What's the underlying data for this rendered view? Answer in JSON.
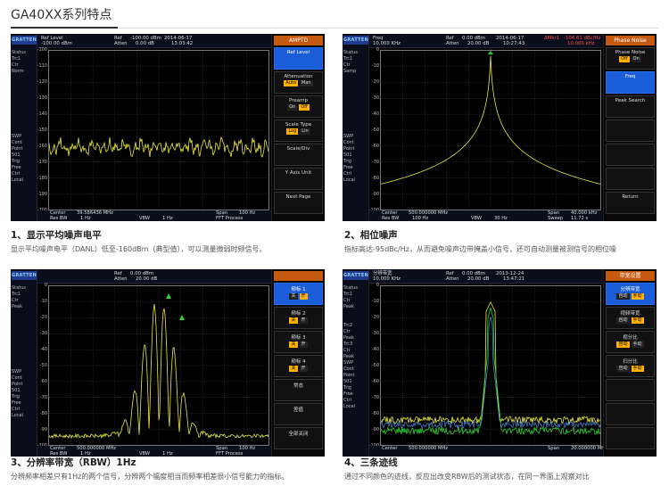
{
  "header": {
    "title": "GA40XX系列特点"
  },
  "brand": "GRATTEN",
  "panels": [
    {
      "top": {
        "ref_label": "Ref Level",
        "ref_val": "-100.00 dBm",
        "ref": "Ref",
        "ref_db": "-100.00 dBm",
        "atten": "Atten",
        "atten_db": "0.00 dB",
        "date": "2014-06-17",
        "time": "13:03:42"
      },
      "status": [
        "Status",
        "Trc1",
        "Ctr",
        "Norm"
      ],
      "side": [
        "SWP",
        "Cont",
        "Point",
        "501",
        "Trig",
        "Free",
        "Ctrl",
        "Local"
      ],
      "yaxis": [
        "-100",
        "-110",
        "-120",
        "-130",
        "-140",
        "-150",
        "-160",
        "-170",
        "-180",
        "-190",
        "-200"
      ],
      "bottom": {
        "center": "Center",
        "center_v": "39.586436 MHz",
        "rbw": "Res BW",
        "rbw_v": "1 Hz",
        "vbw": "VBW",
        "vbw_v": "1 Hz",
        "span": "Span",
        "span_v": "100 Hz",
        "fft": "FFT Process"
      },
      "menu_title": "AMPTD",
      "softkeys": [
        {
          "label": "Ref Level",
          "active": true
        },
        {
          "label": "Attenuation",
          "opts": [
            "Auto",
            "Man"
          ],
          "on": 0
        },
        {
          "label": "Preamp",
          "opts": [
            "On",
            "Off"
          ],
          "on": 1
        },
        {
          "label": "Scale Type",
          "opts": [
            "Log",
            "Lin"
          ],
          "on": 0
        },
        {
          "label": "Scale/Div"
        },
        {
          "label": "Y Axis Unit"
        },
        {
          "label": "Next Page"
        }
      ]
    },
    {
      "top": {
        "ref_label": "Freq",
        "ref_val": "10.000 KHz",
        "ref": "Ref",
        "ref_db": "0.00 dBm",
        "atten": "Atten",
        "atten_db": "20.00 dB",
        "date": "2014-06-17",
        "time": "10:27:43",
        "mk_label": "ΔMkr1",
        "mk_val": "-104.61 dBc/Hz",
        "mk_f": "10.000 kHz"
      },
      "status": [
        "Status",
        "Trc1",
        "Ctr",
        "Samp"
      ],
      "side": [
        "SWP",
        "Cont",
        "Point",
        "501",
        "Trig",
        "Free",
        "Ctrl",
        "Local"
      ],
      "yaxis": [
        "0",
        "-10",
        "-20",
        "-30",
        "-40",
        "-50",
        "-60",
        "-70",
        "-80",
        "-90",
        "-100"
      ],
      "bottom": {
        "center": "Center",
        "center_v": "500.000000 MHz",
        "rbw": "Res BW",
        "rbw_v": "100 Hz",
        "vbw": "VBW",
        "vbw_v": "30 Hz",
        "span": "Span",
        "span_v": "40.000 kHz",
        "fft": "Sweep",
        "sweep_v": "11.72 s"
      },
      "menu_title": "Phase Noise",
      "softkeys": [
        {
          "label": "Phase Noise",
          "opts": [
            "Off",
            "On"
          ],
          "on": 0
        },
        {
          "label": "Freq",
          "active": true
        },
        {
          "label": "Peak Search"
        },
        {
          "label": ""
        },
        {
          "label": ""
        },
        {
          "label": ""
        },
        {
          "label": "Return"
        }
      ]
    },
    {
      "top": {
        "ref_label": "",
        "ref_val": "",
        "ref": "Ref",
        "ref_db": "0.00 dBm",
        "atten": "Atten",
        "atten_db": "20.00 dB",
        "date": "",
        "time": ""
      },
      "status": [
        "Status",
        "Trc1",
        "Ctr",
        "Peak"
      ],
      "side": [
        "SWP",
        "Cont",
        "Point",
        "501",
        "Trig",
        "Free",
        "Ctrl",
        "Local"
      ],
      "yaxis": [
        "0",
        "-10",
        "-20",
        "-30",
        "-40",
        "-50",
        "-60",
        "-70",
        "-80",
        "-90",
        "-100"
      ],
      "bottom": {
        "center": "Center",
        "center_v": "500.000000 MHz",
        "rbw": "Res BW",
        "rbw_v": "1 Hz",
        "vbw": "VBW",
        "vbw_v": "1 Hz",
        "span": "Span",
        "span_v": "100 Hz",
        "fft": "FFT Process"
      },
      "menu_title": "",
      "softkeys": [
        {
          "label": "频标 1",
          "opts": [
            "关",
            "开"
          ],
          "on": 1,
          "active": true
        },
        {
          "label": "频标 2",
          "opts": [
            "关",
            "开"
          ],
          "on": 0
        },
        {
          "label": "频标 3",
          "opts": [
            "关",
            "开"
          ],
          "on": 0
        },
        {
          "label": "频标 4",
          "opts": [
            "关",
            "开"
          ],
          "on": 0
        },
        {
          "label": "常态"
        },
        {
          "label": "差值"
        },
        {
          "label": "全部关闭"
        }
      ]
    },
    {
      "top": {
        "ref_label": "分辨带宽",
        "ref_val": "10.000 KHz",
        "ref": "Ref",
        "ref_db": "0.00 dBm",
        "atten": "Atten",
        "atten_db": "20.00 dB",
        "date": "2013-12-24",
        "time": "13:47:21"
      },
      "status": [
        "Status",
        "Trc1",
        "Ctr",
        "Peak"
      ],
      "side": [
        "Trc2",
        "Ctr",
        "Peak",
        "Trc3",
        "Ctr",
        "Peak",
        "SWP",
        "Cont",
        "Point",
        "501",
        "Trig",
        "Free",
        "Ctrl",
        "Local"
      ],
      "yaxis": [
        "0",
        "-10",
        "-20",
        "-30",
        "-40",
        "-50",
        "-60",
        "-70",
        "-80",
        "-90",
        "-100"
      ],
      "bottom": {
        "center": "Center",
        "center_v": "500.000000 MHz",
        "rbw": "",
        "rbw_v": "",
        "vbw": "",
        "vbw_v": "",
        "span": "Span",
        "span_v": "20.000000 MHz",
        "fft": ""
      },
      "menu_title": "带宽设置",
      "softkeys": [
        {
          "label": "分辨带宽",
          "opts": [
            "自动",
            "手动"
          ],
          "on": 1,
          "active": true
        },
        {
          "label": "视频带宽",
          "opts": [
            "自动",
            "手动"
          ],
          "on": 1
        },
        {
          "label": "视分比",
          "opts": [
            "自动",
            "手动"
          ],
          "on": 0
        },
        {
          "label": "扫分比",
          "opts": [
            "自动",
            "手动"
          ],
          "on": 1
        },
        {
          "label": ""
        },
        {
          "label": ""
        },
        {
          "label": ""
        }
      ]
    }
  ],
  "captions": [
    {
      "head": "1、显示平均噪声电平",
      "text": "显示平均噪声电平（DANL）低至-160dBm（典型值），可以测量微弱时频信号。"
    },
    {
      "head": "2、相位噪声",
      "text": "指标高达-95dBc/Hz，从而避免噪声边带掩盖小信号，还可自动测量被测信号的相位噪"
    },
    {
      "head": "3、分辨率带宽（RBW）1Hz",
      "text": "分辨频率相差只有1Hz的两个信号，分辨两个幅度相当而频率相差很小信号能力的指标。"
    },
    {
      "head": "4、三条迹线",
      "text": "通过不同颜色的迹线，反应出改变RBW后的测试状态，在同一界面上观察对比"
    }
  ],
  "colors": {
    "trace": "#e8e840",
    "trace2": "#30d030",
    "trace3": "#50a0ff",
    "active": "#1b5dd8",
    "title_bar": "#c55a10",
    "toggle_on": "#ffb000"
  }
}
